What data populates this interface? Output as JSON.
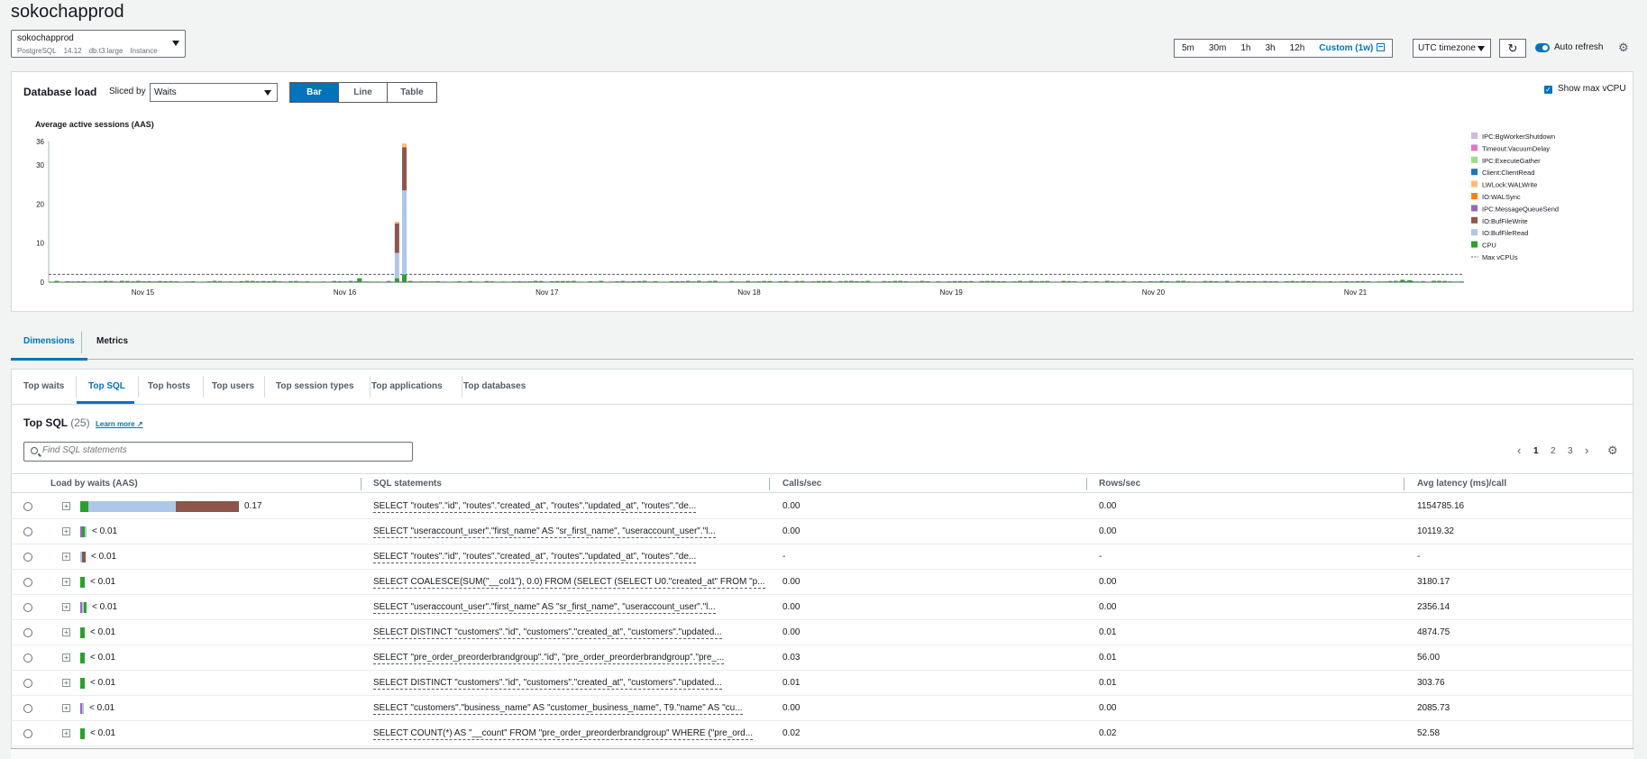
{
  "header": {
    "title": "sokochapprod",
    "instance": {
      "name": "sokochapprod",
      "engine": "PostgreSQL",
      "version": "14.12",
      "class": "db.t3.large",
      "role": "Instance"
    },
    "time_ranges": [
      "5m",
      "30m",
      "1h",
      "3h",
      "12h",
      "Custom (1w)"
    ],
    "selected_range": "Custom (1w)",
    "timezone": "UTC timezone",
    "auto_refresh_label": "Auto refresh",
    "auto_refresh_on": true
  },
  "load_panel": {
    "title": "Database load",
    "sliced_by_label": "Sliced by",
    "sliced_by_value": "Waits",
    "views": [
      "Bar",
      "Line",
      "Table"
    ],
    "selected_view": "Bar",
    "show_max_vcpu_label": "Show max vCPU",
    "show_max_vcpu": true
  },
  "chart_data": {
    "type": "bar",
    "ylabel": "Average active sessions (AAS)",
    "yticks": [
      0,
      10,
      20,
      30,
      36
    ],
    "ylim": [
      0,
      36
    ],
    "x_ticks": [
      "Nov 15",
      "Nov 16",
      "Nov 17",
      "Nov 18",
      "Nov 19",
      "Nov 20",
      "Nov 21"
    ],
    "max_vcpu": 2,
    "legend": [
      {
        "name": "IPC:BgWorkerShutdown",
        "color": "#d1b9e0"
      },
      {
        "name": "Timeout:VacuumDelay",
        "color": "#e377c2"
      },
      {
        "name": "IPC:ExecuteGather",
        "color": "#98df8a"
      },
      {
        "name": "Client:ClientRead",
        "color": "#1f77b4"
      },
      {
        "name": "LWLock:WALWrite",
        "color": "#ffbb78"
      },
      {
        "name": "IO:WALSync",
        "color": "#ff7f0e"
      },
      {
        "name": "IPC:MessageQueueSend",
        "color": "#9467bd"
      },
      {
        "name": "IO:BufFileWrite",
        "color": "#8c564b"
      },
      {
        "name": "IO:BufFileRead",
        "color": "#aec7e8"
      },
      {
        "name": "CPU",
        "color": "#2ca02c"
      },
      {
        "name": "Max vCPUs",
        "color": "#545b64"
      }
    ],
    "spikes": [
      {
        "x_frac": 0.254,
        "segments": {
          "CPU": 0.3
        }
      },
      {
        "x_frac": 0.218,
        "segments": {
          "CPU": 1.0
        }
      },
      {
        "x_frac": 0.2445,
        "segments": {
          "CPU": 1.0,
          "IO:BufFileRead": 6.5,
          "IO:BufFileWrite": 7.5,
          "LWLock:WALWrite": 0.5
        }
      },
      {
        "x_frac": 0.2497,
        "segments": {
          "CPU": 2.0,
          "IO:BufFileRead": 21.5,
          "IO:BufFileWrite": 11.0,
          "LWLock:WALWrite": 1.0
        }
      },
      {
        "x_frac": 0.955,
        "segments": {
          "CPU": 0.6
        }
      },
      {
        "x_frac": 0.96,
        "segments": {
          "CPU": 0.5
        }
      }
    ]
  },
  "tabs": {
    "items": [
      "Dimensions",
      "Metrics"
    ],
    "selected": "Dimensions"
  },
  "subtabs": {
    "items": [
      "Top waits",
      "Top SQL",
      "Top hosts",
      "Top users",
      "Top session types",
      "Top applications",
      "Top databases"
    ],
    "selected": "Top SQL"
  },
  "top_sql": {
    "title": "Top SQL",
    "count": "(25)",
    "learn_more": "Learn more",
    "search_placeholder": "Find SQL statements",
    "pages": [
      "1",
      "2",
      "3"
    ],
    "current_page": "1",
    "columns": [
      "Load by waits (AAS)",
      "SQL statements",
      "Calls/sec",
      "Rows/sec",
      "Avg latency (ms)/call"
    ],
    "rows": [
      {
        "load": "0.17",
        "bars": [
          [
            "#2ca02c",
            9
          ],
          [
            "#aec7e8",
            97
          ],
          [
            "#8c564b",
            70
          ]
        ],
        "sql": "SELECT \"routes\".\"id\", \"routes\".\"created_at\", \"routes\".\"updated_at\", \"routes\".\"de...",
        "calls": "0.00",
        "rows": "0.00",
        "latency": "1154785.16"
      },
      {
        "load": "< 0.01",
        "bars": [
          [
            "#9467bd",
            2
          ],
          [
            "#2ca02c",
            3
          ],
          [
            "#aec7e8",
            2
          ]
        ],
        "sql": "SELECT \"useraccount_user\".\"first_name\" AS \"sr_first_name\", \"useraccount_user\".\"l...",
        "calls": "0.00",
        "rows": "0.00",
        "latency": "10119.32"
      },
      {
        "load": "< 0.01",
        "bars": [
          [
            "#aec7e8",
            2
          ],
          [
            "#8c564b",
            4
          ]
        ],
        "sql": "SELECT \"routes\".\"id\", \"routes\".\"created_at\", \"routes\".\"updated_at\", \"routes\".\"de...",
        "calls": "-",
        "rows": "-",
        "latency": "-"
      },
      {
        "load": "< 0.01",
        "bars": [
          [
            "#2ca02c",
            5
          ]
        ],
        "sql": "SELECT COALESCE(SUM(\"__col1\"), 0.0) FROM (SELECT (SELECT U0.\"created_at\" FROM \"p...",
        "calls": "0.00",
        "rows": "0.00",
        "latency": "3180.17"
      },
      {
        "load": "< 0.01",
        "bars": [
          [
            "#9467bd",
            2
          ],
          [
            "#aec7e8",
            2
          ],
          [
            "#2ca02c",
            3
          ]
        ],
        "sql": "SELECT \"useraccount_user\".\"first_name\" AS \"sr_first_name\", \"useraccount_user\".\"l...",
        "calls": "0.00",
        "rows": "0.00",
        "latency": "2356.14"
      },
      {
        "load": "< 0.01",
        "bars": [
          [
            "#2ca02c",
            5
          ]
        ],
        "sql": "SELECT DISTINCT \"customers\".\"id\", \"customers\".\"created_at\", \"customers\".\"updated...",
        "calls": "0.00",
        "rows": "0.01",
        "latency": "4874.75"
      },
      {
        "load": "< 0.01",
        "bars": [
          [
            "#2ca02c",
            5
          ]
        ],
        "sql": "SELECT \"pre_order_preorderbrandgroup\".\"id\", \"pre_order_preorderbrandgroup\".\"pre_...",
        "calls": "0.03",
        "rows": "0.01",
        "latency": "56.00"
      },
      {
        "load": "< 0.01",
        "bars": [
          [
            "#2ca02c",
            5
          ]
        ],
        "sql": "SELECT DISTINCT \"customers\".\"id\", \"customers\".\"created_at\", \"customers\".\"updated...",
        "calls": "0.01",
        "rows": "0.01",
        "latency": "303.76"
      },
      {
        "load": "< 0.01",
        "bars": [
          [
            "#9467bd",
            2
          ],
          [
            "#aec7e8",
            2
          ]
        ],
        "sql": "SELECT \"customers\".\"business_name\" AS \"customer_business_name\", T9.\"name\" AS \"cu...",
        "calls": "0.00",
        "rows": "0.00",
        "latency": "2085.73"
      },
      {
        "load": "< 0.01",
        "bars": [
          [
            "#2ca02c",
            5
          ]
        ],
        "sql": "SELECT COUNT(*) AS \"__count\" FROM \"pre_order_preorderbrandgroup\" WHERE (\"pre_ord...",
        "calls": "0.02",
        "rows": "0.02",
        "latency": "52.58"
      }
    ]
  }
}
